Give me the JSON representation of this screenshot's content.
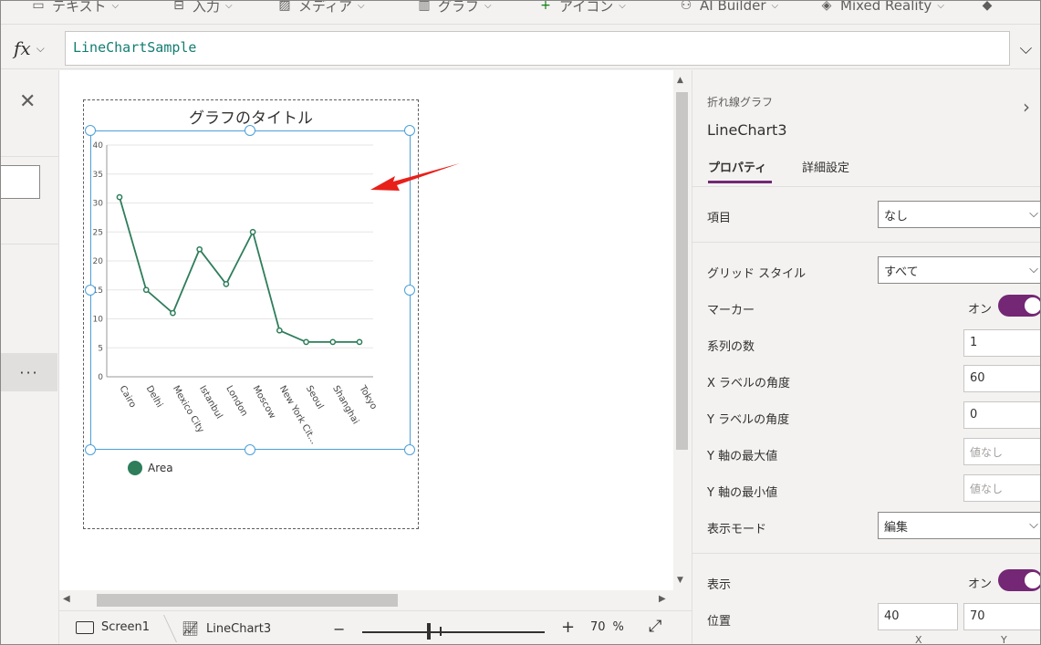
{
  "ribbon": {
    "items": [
      {
        "label": "テキスト",
        "icon": "text-icon"
      },
      {
        "label": "入力",
        "icon": "input-icon"
      },
      {
        "label": "メディア",
        "icon": "media-icon"
      },
      {
        "label": "グラフ",
        "icon": "chart-icon"
      },
      {
        "label": "アイコン",
        "icon": "icons-icon"
      },
      {
        "label": "AI Builder",
        "icon": "ai-builder-icon"
      },
      {
        "label": "Mixed Reality",
        "icon": "mixed-reality-icon"
      }
    ]
  },
  "formula_bar": {
    "fx_label": "fx",
    "value": "LineChartSample"
  },
  "left_panel": {
    "more_label": "···"
  },
  "chart": {
    "title": "グラフのタイトル",
    "legend": "Area",
    "color": "#2e7d5b"
  },
  "chart_data": {
    "type": "line",
    "title": "グラフのタイトル",
    "categories": [
      "Cairo",
      "Delhi",
      "Mexico City",
      "Istanbul",
      "London",
      "Moscow",
      "New York Cit...",
      "Seoul",
      "Shanghai",
      "Tokyo"
    ],
    "series": [
      {
        "name": "Area",
        "values": [
          31,
          15,
          11,
          22,
          16,
          25,
          8,
          6,
          6,
          6
        ]
      }
    ],
    "yticks": [
      0,
      5,
      10,
      15,
      20,
      25,
      30,
      35,
      40
    ],
    "ylim": [
      0,
      40
    ],
    "x_label_angle": 60,
    "grid": true,
    "legend_position": "bottom-left"
  },
  "status_bar": {
    "screen": "Screen1",
    "control": "LineChart3",
    "zoom_minus": "−",
    "zoom_plus": "+",
    "zoom_value": "70",
    "zoom_unit": "%"
  },
  "right_panel": {
    "control_type": "折れ線グラフ",
    "control_name": "LineChart3",
    "tabs": [
      "プロパティ",
      "詳細設定"
    ],
    "properties": {
      "items_label": "項目",
      "items_value": "なし",
      "grid_style_label": "グリッド スタイル",
      "grid_style_value": "すべて",
      "markers_label": "マーカー",
      "markers_value": "オン",
      "series_count_label": "系列の数",
      "series_count_value": "1",
      "x_label_angle_label": "X ラベルの角度",
      "x_label_angle_value": "60",
      "y_label_angle_label": "Y ラベルの角度",
      "y_label_angle_value": "0",
      "y_max_label": "Y 軸の最大値",
      "y_max_placeholder": "値なし",
      "y_min_label": "Y 軸の最小値",
      "y_min_placeholder": "値なし",
      "display_mode_label": "表示モード",
      "display_mode_value": "編集",
      "visible_label": "表示",
      "visible_value": "オン",
      "position_label": "位置",
      "position_x": "40",
      "position_y": "70",
      "x_hint": "X",
      "y_hint": "Y"
    }
  }
}
